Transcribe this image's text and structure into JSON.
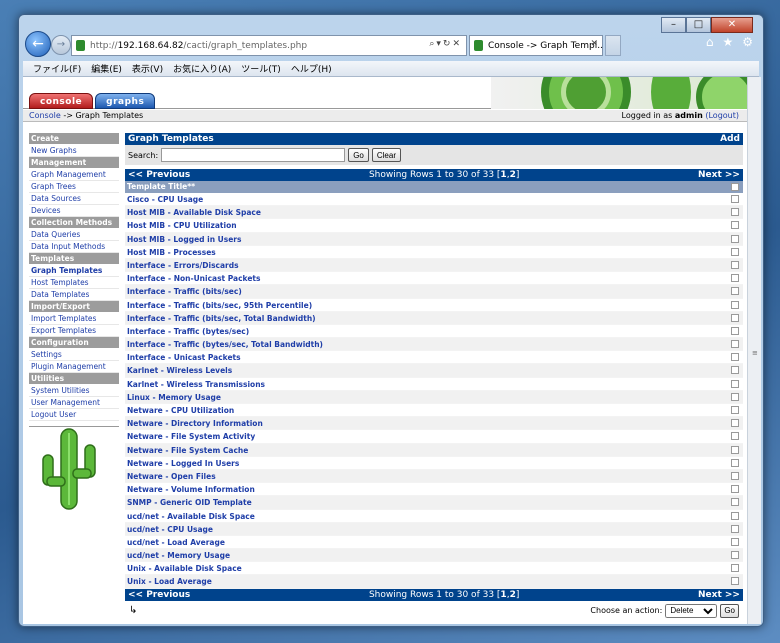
{
  "browser": {
    "url_scheme": "http://",
    "url_host": "192.168.64.82",
    "url_path": "/cacti/graph_templates.php",
    "tab_title": "Console -> Graph Templ...",
    "menu": [
      "ファイル(F)",
      "編集(E)",
      "表示(V)",
      "お気に入り(A)",
      "ツール(T)",
      "ヘルプ(H)"
    ]
  },
  "tabs": {
    "console": "console",
    "graphs": "graphs"
  },
  "crumb": {
    "console": "Console",
    "rest": "-> Graph Templates",
    "logged_prefix": "Logged in as",
    "user": "admin",
    "logout": "(Logout)"
  },
  "sidebar": [
    {
      "type": "h",
      "label": "Create"
    },
    {
      "type": "i",
      "label": "New Graphs"
    },
    {
      "type": "h",
      "label": "Management"
    },
    {
      "type": "i",
      "label": "Graph Management"
    },
    {
      "type": "i",
      "label": "Graph Trees"
    },
    {
      "type": "i",
      "label": "Data Sources"
    },
    {
      "type": "i",
      "label": "Devices"
    },
    {
      "type": "h",
      "label": "Collection Methods"
    },
    {
      "type": "i",
      "label": "Data Queries"
    },
    {
      "type": "i",
      "label": "Data Input Methods"
    },
    {
      "type": "h",
      "label": "Templates"
    },
    {
      "type": "i",
      "label": "Graph Templates",
      "selected": true
    },
    {
      "type": "i",
      "label": "Host Templates"
    },
    {
      "type": "i",
      "label": "Data Templates"
    },
    {
      "type": "h",
      "label": "Import/Export"
    },
    {
      "type": "i",
      "label": "Import Templates"
    },
    {
      "type": "i",
      "label": "Export Templates"
    },
    {
      "type": "h",
      "label": "Configuration"
    },
    {
      "type": "i",
      "label": "Settings"
    },
    {
      "type": "i",
      "label": "Plugin Management"
    },
    {
      "type": "h",
      "label": "Utilities"
    },
    {
      "type": "i",
      "label": "System Utilities"
    },
    {
      "type": "i",
      "label": "User Management"
    },
    {
      "type": "i",
      "label": "Logout User"
    }
  ],
  "main": {
    "title": "Graph Templates",
    "add": "Add",
    "search_label": "Search:",
    "go": "Go",
    "clear": "Clear",
    "prev": "<< Previous",
    "next": "Next >>",
    "showing_prefix": "Showing Rows 1 to 30 of 33 [",
    "page1": "1",
    "page_sep": ",",
    "page2": "2",
    "showing_suffix": "]",
    "column": "Template Title**",
    "rows": [
      "Cisco - CPU Usage",
      "Host MIB - Available Disk Space",
      "Host MIB - CPU Utilization",
      "Host MIB - Logged in Users",
      "Host MIB - Processes",
      "Interface - Errors/Discards",
      "Interface - Non-Unicast Packets",
      "Interface - Traffic (bits/sec)",
      "Interface - Traffic (bits/sec, 95th Percentile)",
      "Interface - Traffic (bits/sec, Total Bandwidth)",
      "Interface - Traffic (bytes/sec)",
      "Interface - Traffic (bytes/sec, Total Bandwidth)",
      "Interface - Unicast Packets",
      "Karlnet - Wireless Levels",
      "Karlnet - Wireless Transmissions",
      "Linux - Memory Usage",
      "Netware - CPU Utilization",
      "Netware - Directory Information",
      "Netware - File System Activity",
      "Netware - File System Cache",
      "Netware - Logged In Users",
      "Netware - Open Files",
      "Netware - Volume Information",
      "SNMP - Generic OID Template",
      "ucd/net - Available Disk Space",
      "ucd/net - CPU Usage",
      "ucd/net - Load Average",
      "ucd/net - Memory Usage",
      "Unix - Available Disk Space",
      "Unix - Load Average"
    ],
    "action_label": "Choose an action:",
    "action_value": "Delete",
    "action_go": "Go"
  }
}
